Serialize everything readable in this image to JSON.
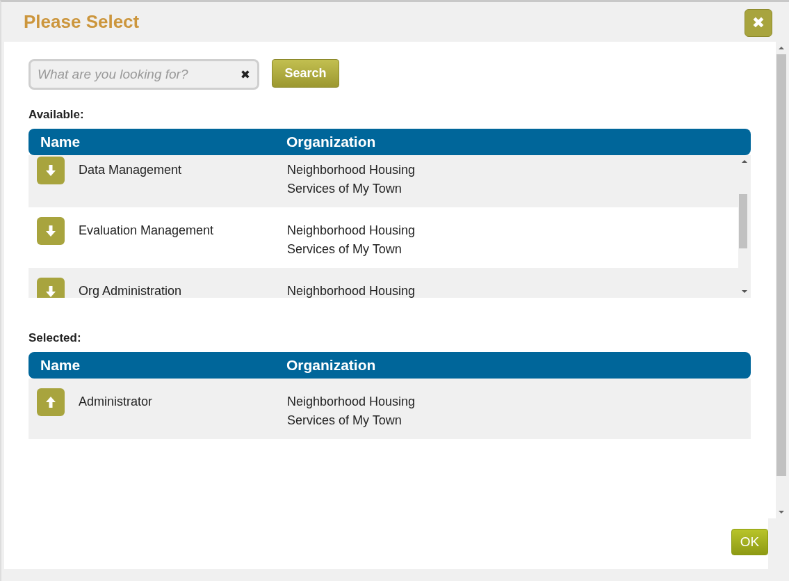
{
  "dialog": {
    "title": "Please Select",
    "close_icon": "✖"
  },
  "search": {
    "placeholder": "What are you looking for?",
    "clear_icon": "✖",
    "button": "Search"
  },
  "sections": [
    {
      "label": "Available:",
      "scrollable": true,
      "columns": [
        "Name",
        "Organization"
      ],
      "rows": [
        {
          "kind": "add",
          "name": "Data Management",
          "organization": "Neighborhood Housing Services of My Town"
        },
        {
          "kind": "add",
          "name": "Evaluation Management",
          "organization": "Neighborhood Housing Services of My Town"
        },
        {
          "kind": "add",
          "name": "Org Administration",
          "organization": "Neighborhood Housing"
        }
      ]
    },
    {
      "label": "Selected:",
      "scrollable": false,
      "columns": [
        "Name",
        "Organization"
      ],
      "rows": [
        {
          "kind": "remove",
          "name": "Administrator",
          "organization": "Neighborhood Housing Services of My Town"
        }
      ]
    }
  ],
  "footer": {
    "ok": "OK"
  }
}
